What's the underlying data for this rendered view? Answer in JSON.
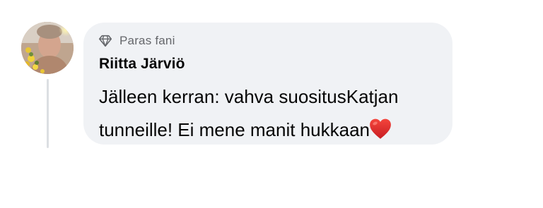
{
  "comment": {
    "badge_icon": "diamond-icon",
    "badge_label": "Paras fani",
    "author": "Riitta Järviö",
    "text": "Jälleen kerran: vahva suositusKatjan tunneille! Ei mene manit hukkaan",
    "emoji": "red-heart-icon"
  },
  "colors": {
    "bubble_background": "#f0f2f5",
    "badge_text": "#65676b",
    "primary_text": "#050505",
    "heart": "#e0262a",
    "thread_line": "#dcdfe3"
  }
}
